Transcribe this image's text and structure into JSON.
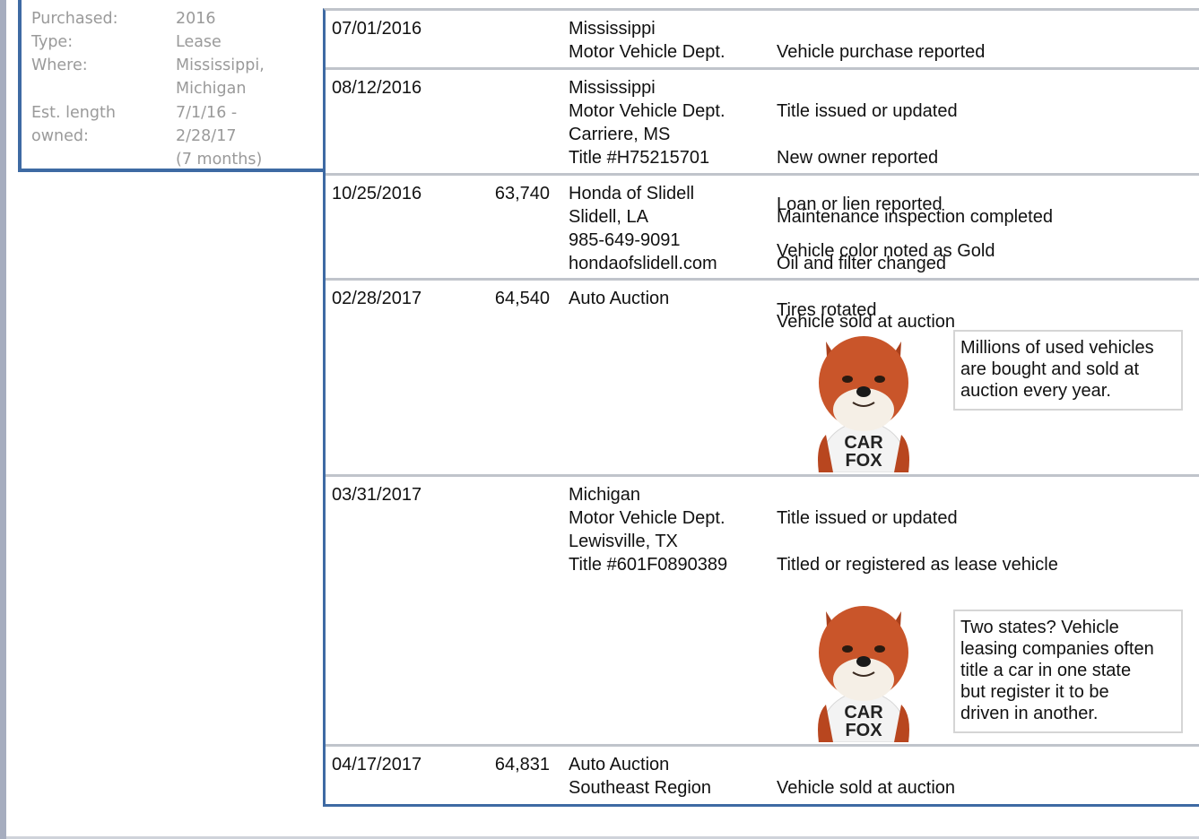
{
  "owner_summary": {
    "rows": [
      {
        "key": "Purchased:",
        "value": "2016"
      },
      {
        "key": "Type:",
        "value": "Lease"
      },
      {
        "key": "Where:",
        "value": "Mississippi,\nMichigan"
      },
      {
        "key": "Est. length\nowned:",
        "value": "7/1/16 -\n2/28/17\n(7 months)"
      }
    ]
  },
  "records": [
    {
      "date": "07/01/2016",
      "odometer": "",
      "source": "Mississippi\nMotor Vehicle Dept.",
      "comments": [
        "Vehicle purchase reported"
      ]
    },
    {
      "date": "08/12/2016",
      "odometer": "",
      "source": "Mississippi\nMotor Vehicle Dept.\nCarriere, MS\nTitle #H75215701",
      "comments": [
        "Title issued or updated",
        "New owner reported",
        "Loan or lien reported",
        "Vehicle color noted as Gold"
      ]
    },
    {
      "date": "10/25/2016",
      "odometer": "63,740",
      "source": "Honda of Slidell\nSlidell, LA\n985-649-9091\nhondaofslidell.com",
      "comments": [
        "Maintenance inspection completed",
        "Oil and filter changed",
        "Tires rotated"
      ]
    },
    {
      "date": "02/28/2017",
      "odometer": "64,540",
      "source": "Auto Auction",
      "comments": [
        "Vehicle sold at auction"
      ],
      "tip": "Millions of used vehicles\nare bought and sold at\nauction every year."
    },
    {
      "date": "03/31/2017",
      "odometer": "",
      "source": "Michigan\nMotor Vehicle Dept.\nLewisville, TX\nTitle #601F0890389",
      "comments": [
        "Title issued or updated",
        "Titled or registered as lease vehicle"
      ],
      "tip": "Two states? Vehicle\nleasing companies often\ntitle a car in one state\nbut register it to be\ndriven in another."
    },
    {
      "date": "04/17/2017",
      "odometer": "64,831",
      "source": "Auto Auction\nSoutheast Region",
      "comments": [
        "Vehicle sold at auction"
      ]
    }
  ],
  "mascot": {
    "shirt_text_line1": "CAR",
    "shirt_text_line2": "FOX",
    "icon": "carfox-mascot-icon"
  },
  "colors": {
    "accent": "#3e6aa3",
    "muted_text": "#9a9a9a",
    "divider": "#c0c4cb",
    "fox_fur": "#c9552a"
  }
}
